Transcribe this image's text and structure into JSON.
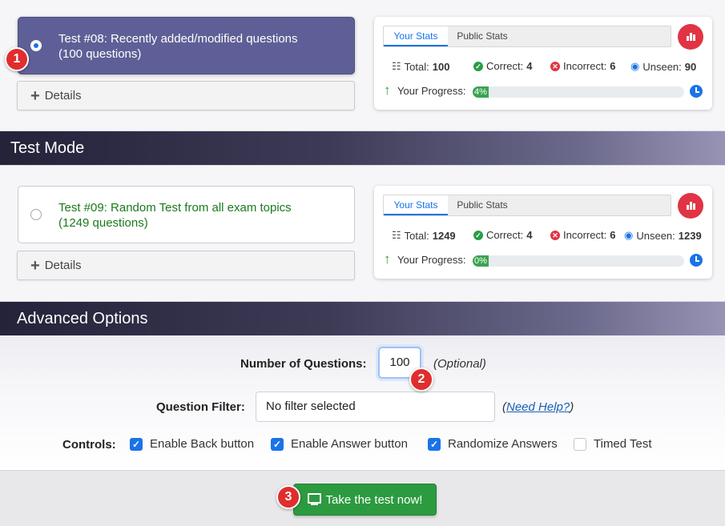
{
  "tests": [
    {
      "title_line1": "Test #08: Recently added/modified questions",
      "title_line2": "(100 questions)",
      "details_label": "Details",
      "stats": {
        "tab_active": "Your Stats",
        "tab_inactive": "Public Stats",
        "total_label": "Total:",
        "total": "100",
        "correct_label": "Correct:",
        "correct": "4",
        "incorrect_label": "Incorrect:",
        "incorrect": "6",
        "unseen_label": "Unseen:",
        "unseen": "90",
        "progress_label": "Your Progress:",
        "progress_text": "4%",
        "progress_pct": 4
      }
    },
    {
      "title_line1": "Test #09: Random Test from all exam topics",
      "title_line2": "(1249 questions)",
      "details_label": "Details",
      "stats": {
        "tab_active": "Your Stats",
        "tab_inactive": "Public Stats",
        "total_label": "Total:",
        "total": "1249",
        "correct_label": "Correct:",
        "correct": "4",
        "incorrect_label": "Incorrect:",
        "incorrect": "6",
        "unseen_label": "Unseen:",
        "unseen": "1239",
        "progress_label": "Your Progress:",
        "progress_text": "0%",
        "progress_pct": 0
      }
    }
  ],
  "sections": {
    "test_mode": "Test Mode",
    "advanced_options": "Advanced Options"
  },
  "advanced": {
    "num_questions_label": "Number of Questions:",
    "num_questions_value": "100",
    "optional_label": "(Optional)",
    "filter_label": "Question Filter:",
    "filter_value": "No filter selected",
    "help_open": "(",
    "help_link": "Need Help?",
    "help_close": ")",
    "controls_label": "Controls:",
    "controls": [
      {
        "label": "Enable Back button",
        "checked": true
      },
      {
        "label": "Enable Answer button",
        "checked": true
      },
      {
        "label": "Randomize Answers",
        "checked": true
      },
      {
        "label": "Timed Test",
        "checked": false
      }
    ]
  },
  "footer": {
    "take_test_label": "Take the test now!"
  },
  "badges": [
    "1",
    "2",
    "3"
  ],
  "colors": {
    "selected_card": "#5f5f97",
    "accent_blue": "#1a73e8",
    "success_green": "#2c9a3f",
    "badge_red": "#e02d2d"
  }
}
